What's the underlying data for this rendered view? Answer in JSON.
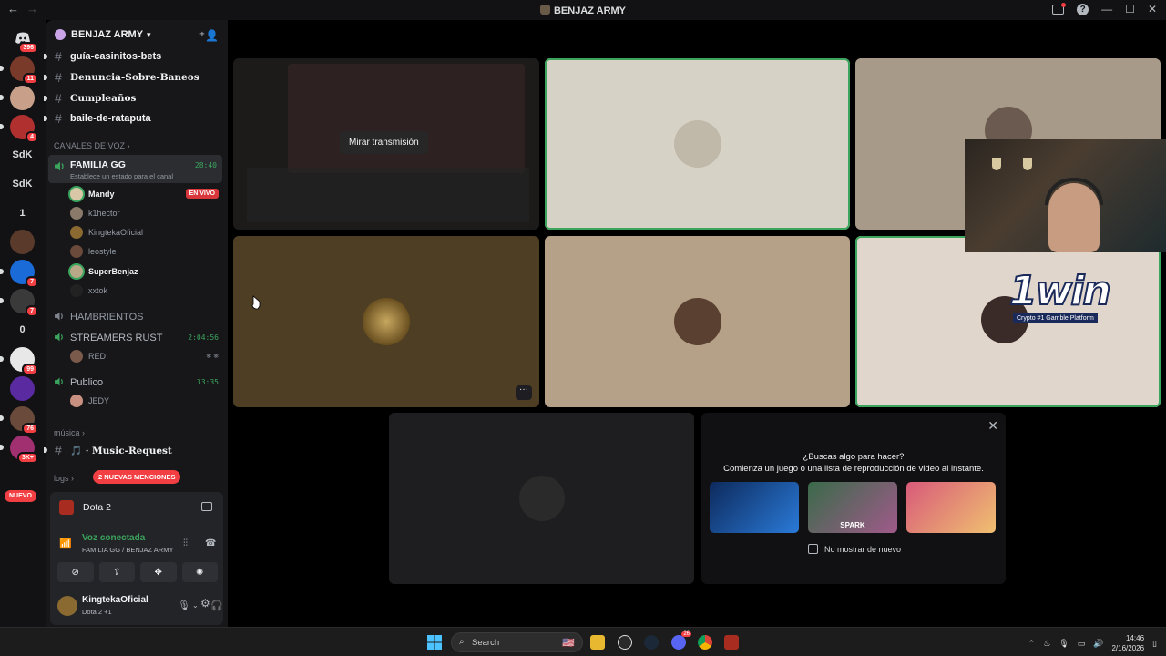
{
  "window": {
    "title": "BENJAZ ARMY",
    "nav_back": "←",
    "nav_forward": "→",
    "min": "—",
    "max": "☐",
    "close": "✕"
  },
  "rail": {
    "dm_badge": "396",
    "servers": [
      {
        "label": "",
        "badge": "11",
        "color": "#7a3a2a"
      },
      {
        "label": "",
        "badge": "",
        "color": "#c8a08a"
      },
      {
        "label": "",
        "badge": "4",
        "color": "#b03030"
      },
      {
        "label": "SdK",
        "badge": "",
        "color": "#121214"
      },
      {
        "label": "SdK",
        "badge": "",
        "color": "#121214"
      },
      {
        "label": "1",
        "badge": "",
        "color": "#121214"
      },
      {
        "label": "",
        "badge": "",
        "color": "#5a3a2a"
      },
      {
        "label": "",
        "badge": "7",
        "color": "#1a6ad8"
      },
      {
        "label": "",
        "badge": "7",
        "color": "#3a3a3a"
      },
      {
        "label": "0",
        "badge": "",
        "color": "#121214"
      },
      {
        "label": "",
        "badge": "99",
        "color": "#e8e8e8"
      },
      {
        "label": "",
        "badge": "",
        "color": "#5a2aa0"
      },
      {
        "label": "",
        "badge": "76",
        "color": "#6a4a3a"
      },
      {
        "label": "",
        "badge": "3K+",
        "color": "#a03070"
      }
    ],
    "nuevo": "NUEVO"
  },
  "sidebar": {
    "server_name": "BENJAZ ARMY",
    "text_channels": [
      {
        "name": "guía-casinitos-bets"
      },
      {
        "name": "Denuncia-Sobre-Baneos"
      },
      {
        "name": "Cumpleaños"
      },
      {
        "name": "baile-de-rataputa"
      }
    ],
    "voice_category": "CANALES DE VOZ",
    "familia": {
      "name": "FAMILIA GG",
      "time": "28:40",
      "status": "Establece un estado para el canal",
      "live_badge": "EN VIVO",
      "members": [
        "Mandy",
        "k1hector",
        "KingtekaOficial",
        "leostyle",
        "SuperBenjaz",
        "xxtok"
      ]
    },
    "hambrientos": "HAMBRIENTOS",
    "streamers": {
      "name": "STREAMERS RUST",
      "time": "2:04:56",
      "member": "RED"
    },
    "publico": {
      "name": "Publico",
      "time": "33:35",
      "member": "JEDY"
    },
    "musica_category": "música",
    "music_channel": "Music-Request",
    "logs_category": "logs",
    "mentions": "2 NUEVAS MENCIONES"
  },
  "panel": {
    "game": "Dota 2",
    "voice_status": "Voz conectada",
    "voice_location": "FAMILIA GG / BENJAZ ARMY",
    "username": "KingtekaOficial",
    "user_status": "Dota 2 +1"
  },
  "stage": {
    "watch_stream": "Mirar transmisión",
    "more": "···",
    "sponsor_tag": "Crypto #1 Gamble Platform",
    "sponsor_logo": "1win"
  },
  "promo": {
    "close": "✕",
    "heading": "¿Buscas algo para hacer?",
    "subheading": "Comienza un juego o una lista de reproducción de video al instante.",
    "cards": [
      {
        "label": "",
        "color": "#0d2a5c"
      },
      {
        "label": "SPARK",
        "color": "#3a6a4a"
      },
      {
        "label": "",
        "color": "#d85a7a"
      }
    ],
    "checkbox": "No mostrar de nuevo"
  },
  "taskbar": {
    "search": "Search",
    "time": "14:46",
    "date": "2/16/2026",
    "discord_badge": "26"
  }
}
